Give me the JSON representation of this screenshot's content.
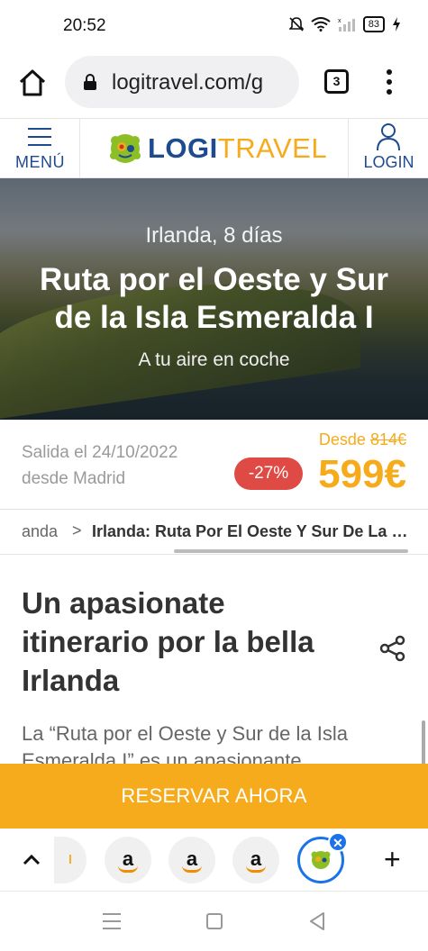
{
  "status_bar": {
    "time": "20:52",
    "battery": "83"
  },
  "browser": {
    "url": "logitravel.com/g",
    "tab_count": "3"
  },
  "header": {
    "menu_label": "MENÚ",
    "logo_part1": "LOGI",
    "logo_part2": "TRAVEL",
    "login_label": "LOGIN"
  },
  "hero": {
    "subtitle": "Irlanda, 8 días",
    "title": "Ruta por el Oeste y Sur de la Isla Esmeralda I",
    "note": "A tu aire en coche"
  },
  "offer": {
    "departure_line1": "Salida el 24/10/2022",
    "departure_line2": "desde Madrid",
    "from_label": "Desde",
    "old_price": "814€",
    "discount": "-27%",
    "price": "599€"
  },
  "breadcrumb": {
    "items": [
      "anda",
      "Irlanda: Ruta Por El Oeste Y Sur De La I..."
    ],
    "separator": ">"
  },
  "article": {
    "title": "Un apasionate itinerario por la bella Irlanda",
    "intro": "La “Ruta por el Oeste y Sur de la Isla Esmeralda I” es un apasionante"
  },
  "cta": {
    "reserve_label": "RESERVAR AHORA"
  },
  "tab_strip": {
    "fav_letter": "a",
    "partial_letter": "l",
    "close_glyph": "✕",
    "add_glyph": "+"
  },
  "colors": {
    "accent": "#f5ab1b",
    "brand_blue": "#1e4b8f",
    "discount_red": "#e04a44",
    "chrome_blue": "#1a73e8"
  }
}
